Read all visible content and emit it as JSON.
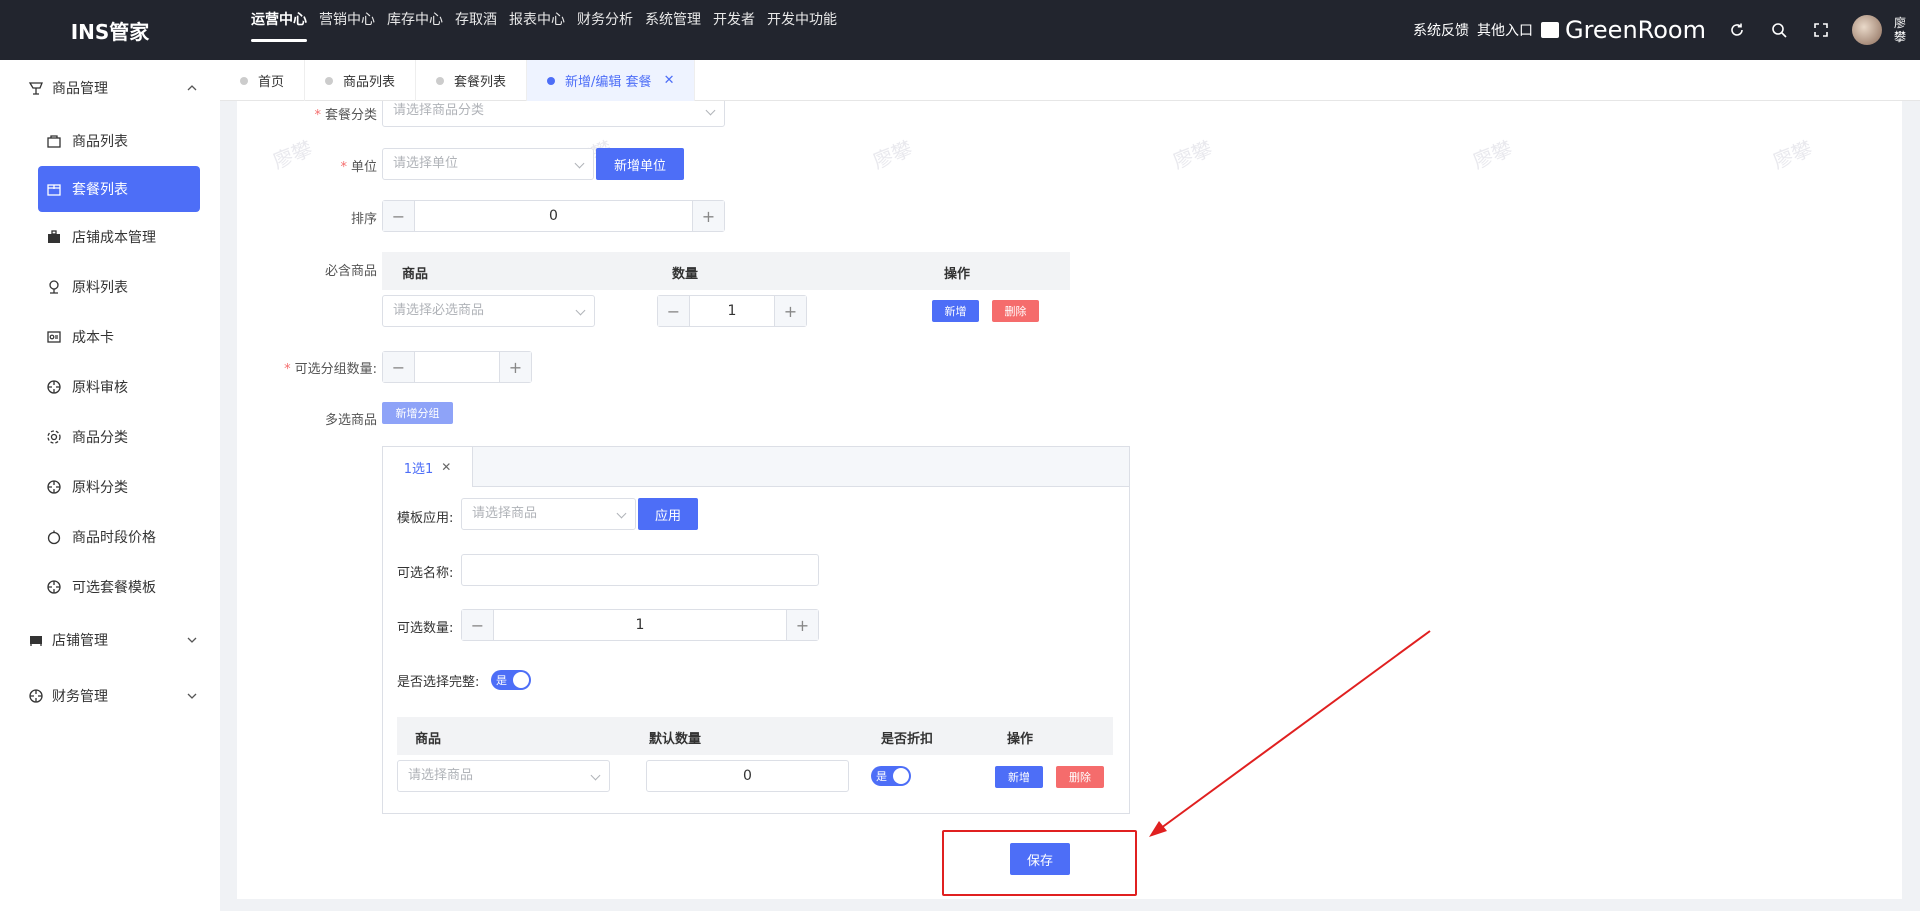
{
  "app": {
    "logo": "INS管家"
  },
  "topnav": [
    {
      "label": "运营中心",
      "active": true
    },
    {
      "label": "营销中心"
    },
    {
      "label": "库存中心"
    },
    {
      "label": "存取酒"
    },
    {
      "label": "报表中心"
    },
    {
      "label": "财务分析"
    },
    {
      "label": "系统管理"
    },
    {
      "label": "开发者"
    },
    {
      "label": "开发中功能"
    }
  ],
  "topright": {
    "feedback": "系统反馈",
    "other_entry": "其他入口",
    "store": "GreenRoom",
    "user": "廖攀"
  },
  "sidebar": {
    "groups": [
      {
        "label": "商品管理",
        "icon": "shop-icon",
        "expanded": true
      },
      {
        "label": "店铺管理",
        "icon": "store-icon"
      },
      {
        "label": "财务管理",
        "icon": "finance-icon"
      }
    ],
    "items": [
      {
        "label": "商品列表"
      },
      {
        "label": "套餐列表",
        "active": true
      },
      {
        "label": "店铺成本管理"
      },
      {
        "label": "原料列表"
      },
      {
        "label": "成本卡"
      },
      {
        "label": "原料审核"
      },
      {
        "label": "商品分类"
      },
      {
        "label": "原料分类"
      },
      {
        "label": "商品时段价格"
      },
      {
        "label": "可选套餐模板"
      }
    ]
  },
  "tabs": [
    {
      "label": "首页"
    },
    {
      "label": "商品列表"
    },
    {
      "label": "套餐列表"
    },
    {
      "label": "新增/编辑 套餐",
      "active": true
    }
  ],
  "form": {
    "category_label": "套餐分类",
    "category_placeholder": "请选择商品分类",
    "unit_label": "单位",
    "unit_placeholder": "请选择单位",
    "add_unit": "新增单位",
    "sort_label": "排序",
    "sort_value": "0",
    "required_label": "必含商品",
    "required_table": {
      "headers": [
        "商品",
        "数量",
        "操作"
      ],
      "product_placeholder": "请选择必选商品",
      "qty": "1",
      "add": "新增",
      "delete": "删除"
    },
    "optional_group_count_label": "可选分组数量:",
    "optional_group_count_value": "",
    "multi_label": "多选商品",
    "add_group": "新增分组",
    "group": {
      "tab_label": "1选1",
      "template_label": "模板应用:",
      "template_placeholder": "请选择商品",
      "apply": "应用",
      "name_label": "可选名称:",
      "name_value": "",
      "count_label": "可选数量:",
      "count_value": "1",
      "complete_label": "是否选择完整:",
      "complete_switch": "是",
      "table": {
        "headers": [
          "商品",
          "默认数量",
          "是否折扣",
          "操作"
        ],
        "product_placeholder": "请选择商品",
        "default_qty": "0",
        "discount_switch": "是",
        "add": "新增",
        "delete": "删除"
      }
    },
    "save": "保存"
  },
  "watermark": "廖攀",
  "colors": {
    "primary": "#4d6ef7",
    "danger": "#f56c6c",
    "annotation": "#e02020",
    "topbar": "#22252e"
  }
}
